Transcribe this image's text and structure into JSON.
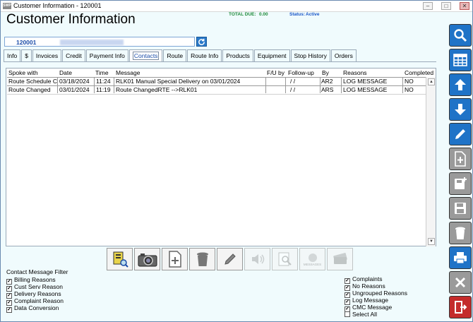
{
  "window": {
    "title": "Customer Information - 120001",
    "logo_text": "SWP"
  },
  "header": {
    "title": "Customer Information",
    "total_due_label": "TOTAL DUE:",
    "total_due_value": "0.00",
    "status_label": "Status:",
    "status_value": "Active"
  },
  "customer": {
    "id": "120001"
  },
  "tabs": [
    {
      "label": "Info"
    },
    {
      "label": "$"
    },
    {
      "label": "Invoices"
    },
    {
      "label": "Credit"
    },
    {
      "label": "Payment Info"
    },
    {
      "label": "Contacts",
      "active": true
    },
    {
      "label": "Route"
    },
    {
      "label": "Route Info"
    },
    {
      "label": "Products"
    },
    {
      "label": "Equipment"
    },
    {
      "label": "Stop History"
    },
    {
      "label": "Orders"
    }
  ],
  "grid": {
    "columns": [
      "Spoke with",
      "Date",
      "Time",
      "Message",
      "F/U by",
      "Follow-up",
      "By",
      "Reasons",
      "Completed"
    ],
    "rows": [
      [
        "Route Schedule C",
        "03/18/2024",
        "11:24",
        "RLK01 Manual Special Delivery on 03/01/2024",
        "",
        " /  /",
        "AR2",
        "LOG MESSAGE",
        "NO"
      ],
      [
        "Route Changed",
        "03/01/2024",
        "11:19",
        "Route ChangedRTE  -->RLK01",
        "",
        " /  /",
        "ARS",
        "LOG MESSAGE",
        "NO"
      ]
    ]
  },
  "toolbar": {
    "messages_label": "MESSAGES",
    "buttons": [
      "account-search",
      "camera",
      "add-document",
      "delete",
      "edit",
      "audio",
      "search-document",
      "messages",
      "money"
    ]
  },
  "filters": {
    "title": "Contact Message Filter",
    "left": [
      {
        "label": "Billing Reasons",
        "checked": true
      },
      {
        "label": "Cust Serv Reason",
        "checked": true
      },
      {
        "label": "Delivery Reasons",
        "checked": true
      },
      {
        "label": "Complaint Reason",
        "checked": true
      },
      {
        "label": "Data Conversion",
        "checked": true
      }
    ],
    "right": [
      {
        "label": "Complaints",
        "checked": true
      },
      {
        "label": "No Reasons",
        "checked": true
      },
      {
        "label": "Ungrouped Reasons",
        "checked": true
      },
      {
        "label": "Log Message",
        "checked": true
      },
      {
        "label": "CMC Message",
        "checked": true
      },
      {
        "label": "Select All",
        "checked": false
      }
    ]
  },
  "sidebar": {
    "buttons": [
      "search",
      "grid",
      "arrow-up",
      "arrow-down",
      "edit",
      "add-document",
      "add-save",
      "save",
      "delete",
      "print",
      "close",
      "exit"
    ]
  },
  "colors": {
    "accent_blue": "#1f73c7",
    "disabled_gray": "#9a9a9a",
    "exit_red": "#c42b2b",
    "total_due_green": "#1e8a3a"
  }
}
